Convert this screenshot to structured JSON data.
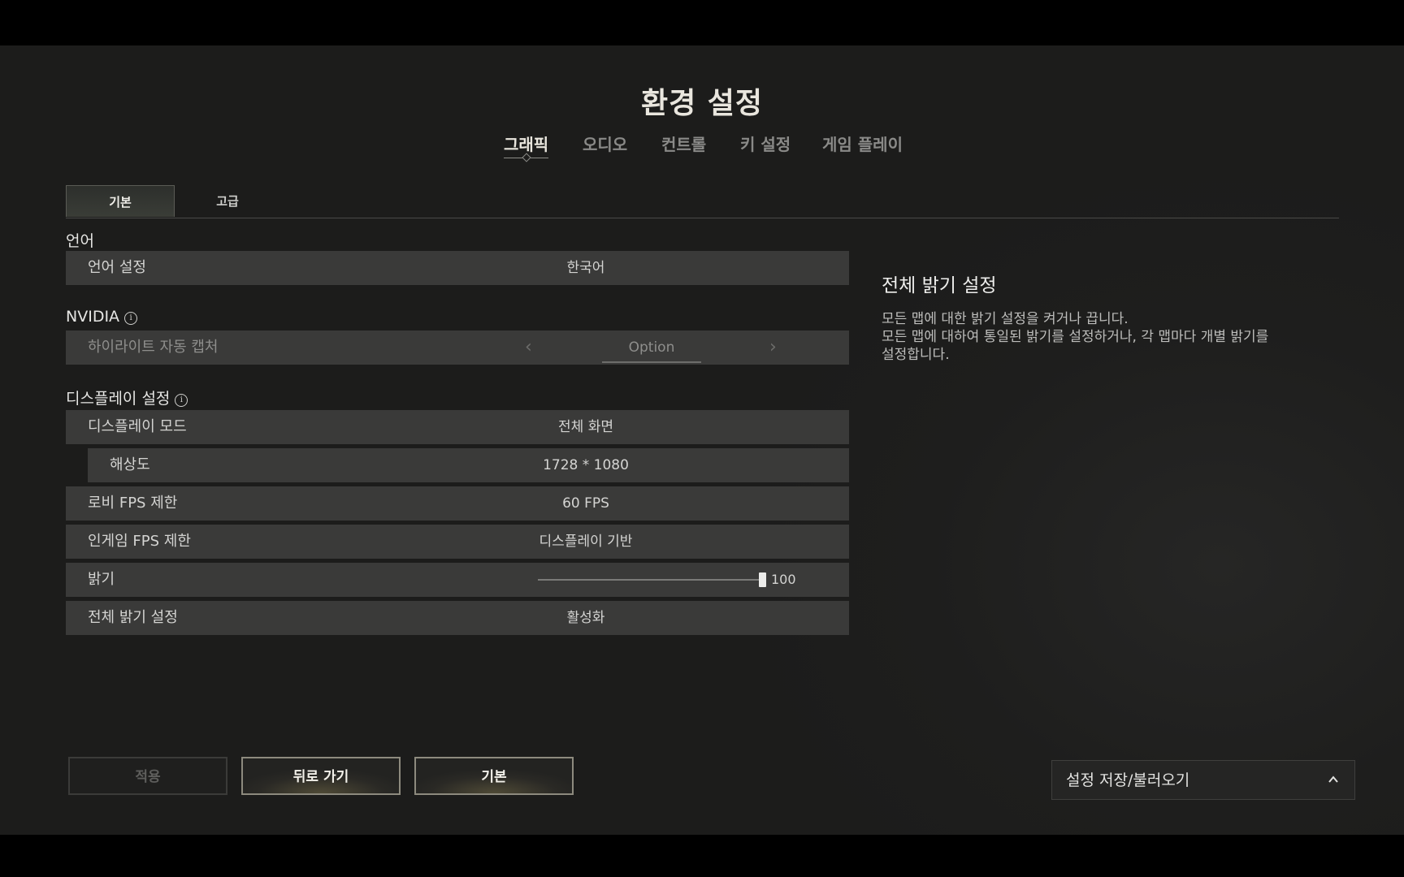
{
  "title": "환경 설정",
  "main_tabs": [
    {
      "label": "그래픽",
      "active": true
    },
    {
      "label": "오디오",
      "active": false
    },
    {
      "label": "컨트롤",
      "active": false
    },
    {
      "label": "키 설정",
      "active": false
    },
    {
      "label": "게임 플레이",
      "active": false
    }
  ],
  "sub_tabs": [
    {
      "label": "기본",
      "active": true
    },
    {
      "label": "고급",
      "active": false
    }
  ],
  "sections": {
    "language": {
      "label": "언어",
      "rows": {
        "language_setting": {
          "label": "언어 설정",
          "value": "한국어"
        }
      }
    },
    "nvidia": {
      "label": "NVIDIA",
      "info_icon": "info-icon",
      "rows": {
        "highlight_capture": {
          "label": "하이라이트 자동 캡처",
          "value": "Option",
          "disabled": true
        }
      }
    },
    "display": {
      "label": "디스플레이 설정",
      "info_icon": "info-icon",
      "rows": {
        "display_mode": {
          "label": "디스플레이 모드",
          "value": "전체 화면"
        },
        "resolution": {
          "label": "해상도",
          "value": "1728 * 1080"
        },
        "lobby_fps": {
          "label": "로비 FPS 제한",
          "value": "60 FPS"
        },
        "ingame_fps": {
          "label": "인게임 FPS 제한",
          "value": "디스플레이 기반"
        },
        "brightness": {
          "label": "밝기",
          "value": "100",
          "level": 100,
          "min": 0,
          "max": 100
        },
        "global_brightness": {
          "label": "전체 밝기 설정",
          "value": "활성화"
        }
      }
    }
  },
  "description": {
    "title": "전체 밝기 설정",
    "lines": [
      "모든 맵에 대한 밝기 설정을 켜거나 끕니다.",
      "모든 맵에 대하여 통일된 밝기를 설정하거나, 각 맵마다 개별 밝기를",
      "설정합니다."
    ]
  },
  "buttons": {
    "apply": "적용",
    "back": "뒤로 가기",
    "default": "기본"
  },
  "save_load": {
    "label": "설정 저장/불러오기",
    "icon": "chevron-up-icon"
  }
}
